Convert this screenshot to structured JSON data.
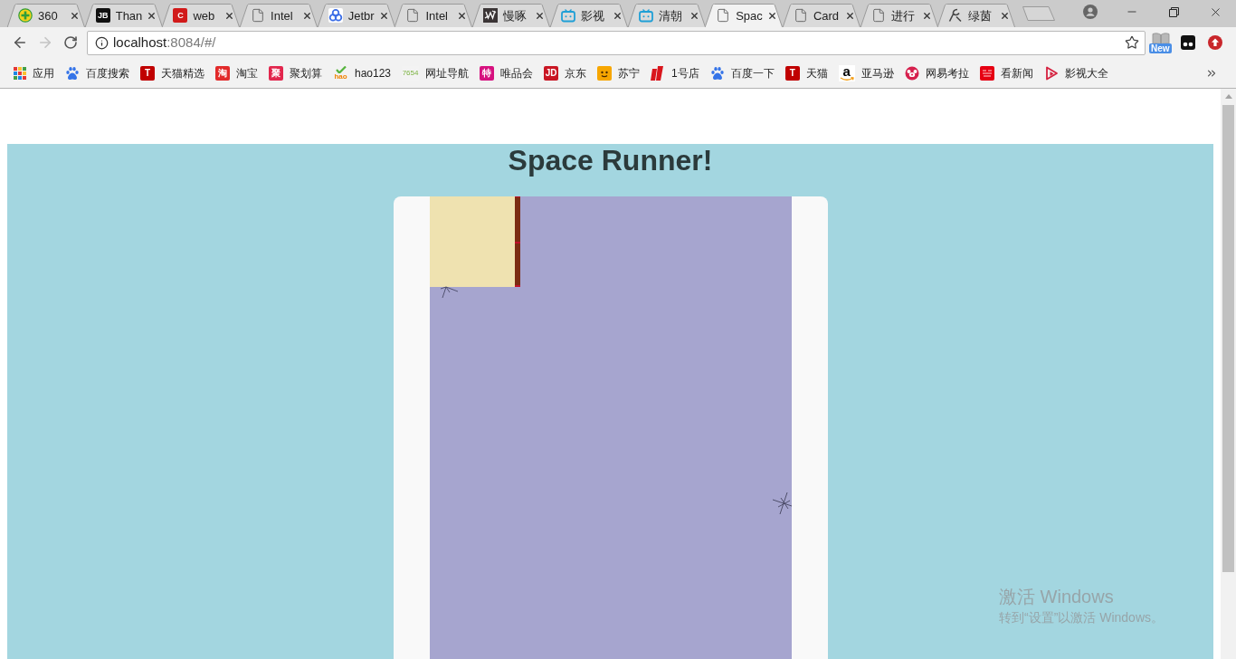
{
  "browser": {
    "tabs": [
      {
        "label": "360",
        "kind": "plus-circle",
        "selected": false
      },
      {
        "label": "Than",
        "kind": "tile",
        "logo": "JB",
        "color": "#111111",
        "selected": false
      },
      {
        "label": "web",
        "kind": "tile",
        "logo": "C",
        "color": "#d11a1a",
        "selected": false
      },
      {
        "label": "Intel",
        "kind": "page",
        "selected": false
      },
      {
        "label": "Jetbr",
        "kind": "rings",
        "selected": false
      },
      {
        "label": "Intel",
        "kind": "page",
        "selected": false
      },
      {
        "label": "慢啄",
        "kind": "pattern",
        "selected": false
      },
      {
        "label": "影视",
        "kind": "tv",
        "selected": false
      },
      {
        "label": "清朝",
        "kind": "tv",
        "selected": false
      },
      {
        "label": "Spac",
        "kind": "page",
        "selected": true
      },
      {
        "label": "Card",
        "kind": "page",
        "selected": false
      },
      {
        "label": "进行",
        "kind": "page",
        "selected": false
      },
      {
        "label": "绿茵",
        "kind": "hook",
        "selected": false
      }
    ],
    "nav_buttons": [
      {
        "kind": "back",
        "disabled": false
      },
      {
        "kind": "forward",
        "disabled": true
      },
      {
        "kind": "reload",
        "disabled": false
      }
    ],
    "address": {
      "host": "localhost",
      "path": ":8084/#/"
    },
    "extension_badge": "New",
    "bookmarks": [
      {
        "label": "应用",
        "kind": "apps"
      },
      {
        "label": "百度搜索",
        "kind": "paw"
      },
      {
        "label": "天猫精选",
        "kind": "tile",
        "logo": "T",
        "color": "#c00000"
      },
      {
        "label": "淘宝",
        "kind": "tile",
        "logo": "淘",
        "color": "#e22a2a"
      },
      {
        "label": "聚划算",
        "kind": "tile",
        "logo": "聚",
        "color": "#e2264d"
      },
      {
        "label": "hao123",
        "kind": "leaf",
        "logo": "hao"
      },
      {
        "label": "网址导航",
        "kind": "light-tile",
        "logo": "7654"
      },
      {
        "label": "唯品会",
        "kind": "tile",
        "logo": "特",
        "color": "#d6117f"
      },
      {
        "label": "京东",
        "kind": "tile",
        "logo": "JD",
        "color": "#c91623"
      },
      {
        "label": "苏宁",
        "kind": "face"
      },
      {
        "label": "1号店",
        "kind": "stripes"
      },
      {
        "label": "百度一下",
        "kind": "paw"
      },
      {
        "label": "天猫",
        "kind": "tile",
        "logo": "T",
        "color": "#c00000"
      },
      {
        "label": "亚马逊",
        "kind": "amazon",
        "logo": "a"
      },
      {
        "label": "网易考拉",
        "kind": "koala"
      },
      {
        "label": "看新闻",
        "kind": "news"
      },
      {
        "label": "影视大全",
        "kind": "play"
      }
    ]
  },
  "page": {
    "title": "Space Runner!"
  },
  "system_notice": {
    "title": "激活 Windows",
    "subtitle": "转到“设置”以激活 Windows。"
  }
}
